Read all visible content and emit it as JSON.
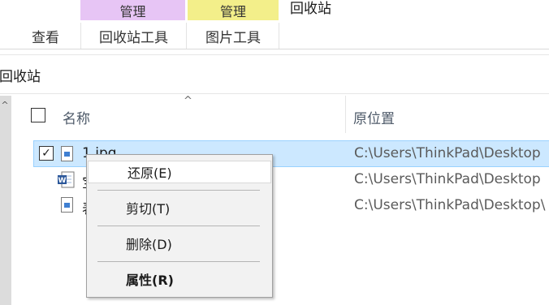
{
  "ribbon": {
    "context_tab_recycle": "管理",
    "context_tab_picture": "管理",
    "window_title": "回收站",
    "tabs": [
      {
        "label": "查看"
      },
      {
        "label": "回收站工具"
      },
      {
        "label": "图片工具"
      }
    ]
  },
  "address_bar": {
    "path": "回收站"
  },
  "columns": {
    "name": "名称",
    "original_location": "原位置"
  },
  "rows": [
    {
      "name": "1.jpg",
      "location": "C:\\Users\\ThinkPad\\Desktop",
      "selected": true,
      "icon": "image-file-icon"
    },
    {
      "name": "宝",
      "location": "C:\\Users\\ThinkPad\\Desktop",
      "selected": false,
      "icon": "word-file-icon"
    },
    {
      "name": "表",
      "location": "C:\\Users\\ThinkPad\\Desktop\\",
      "selected": false,
      "icon": "image-file-icon"
    }
  ],
  "context_menu": {
    "items": [
      {
        "label": "还原(E)"
      },
      {
        "label": "剪切(T)"
      },
      {
        "label": "删除(D)"
      },
      {
        "label": "属性(R)"
      }
    ]
  },
  "colors": {
    "selection": "#cce8ff",
    "context_tab_purple": "#e7c5f5",
    "context_tab_yellow": "#f3ef8a"
  }
}
